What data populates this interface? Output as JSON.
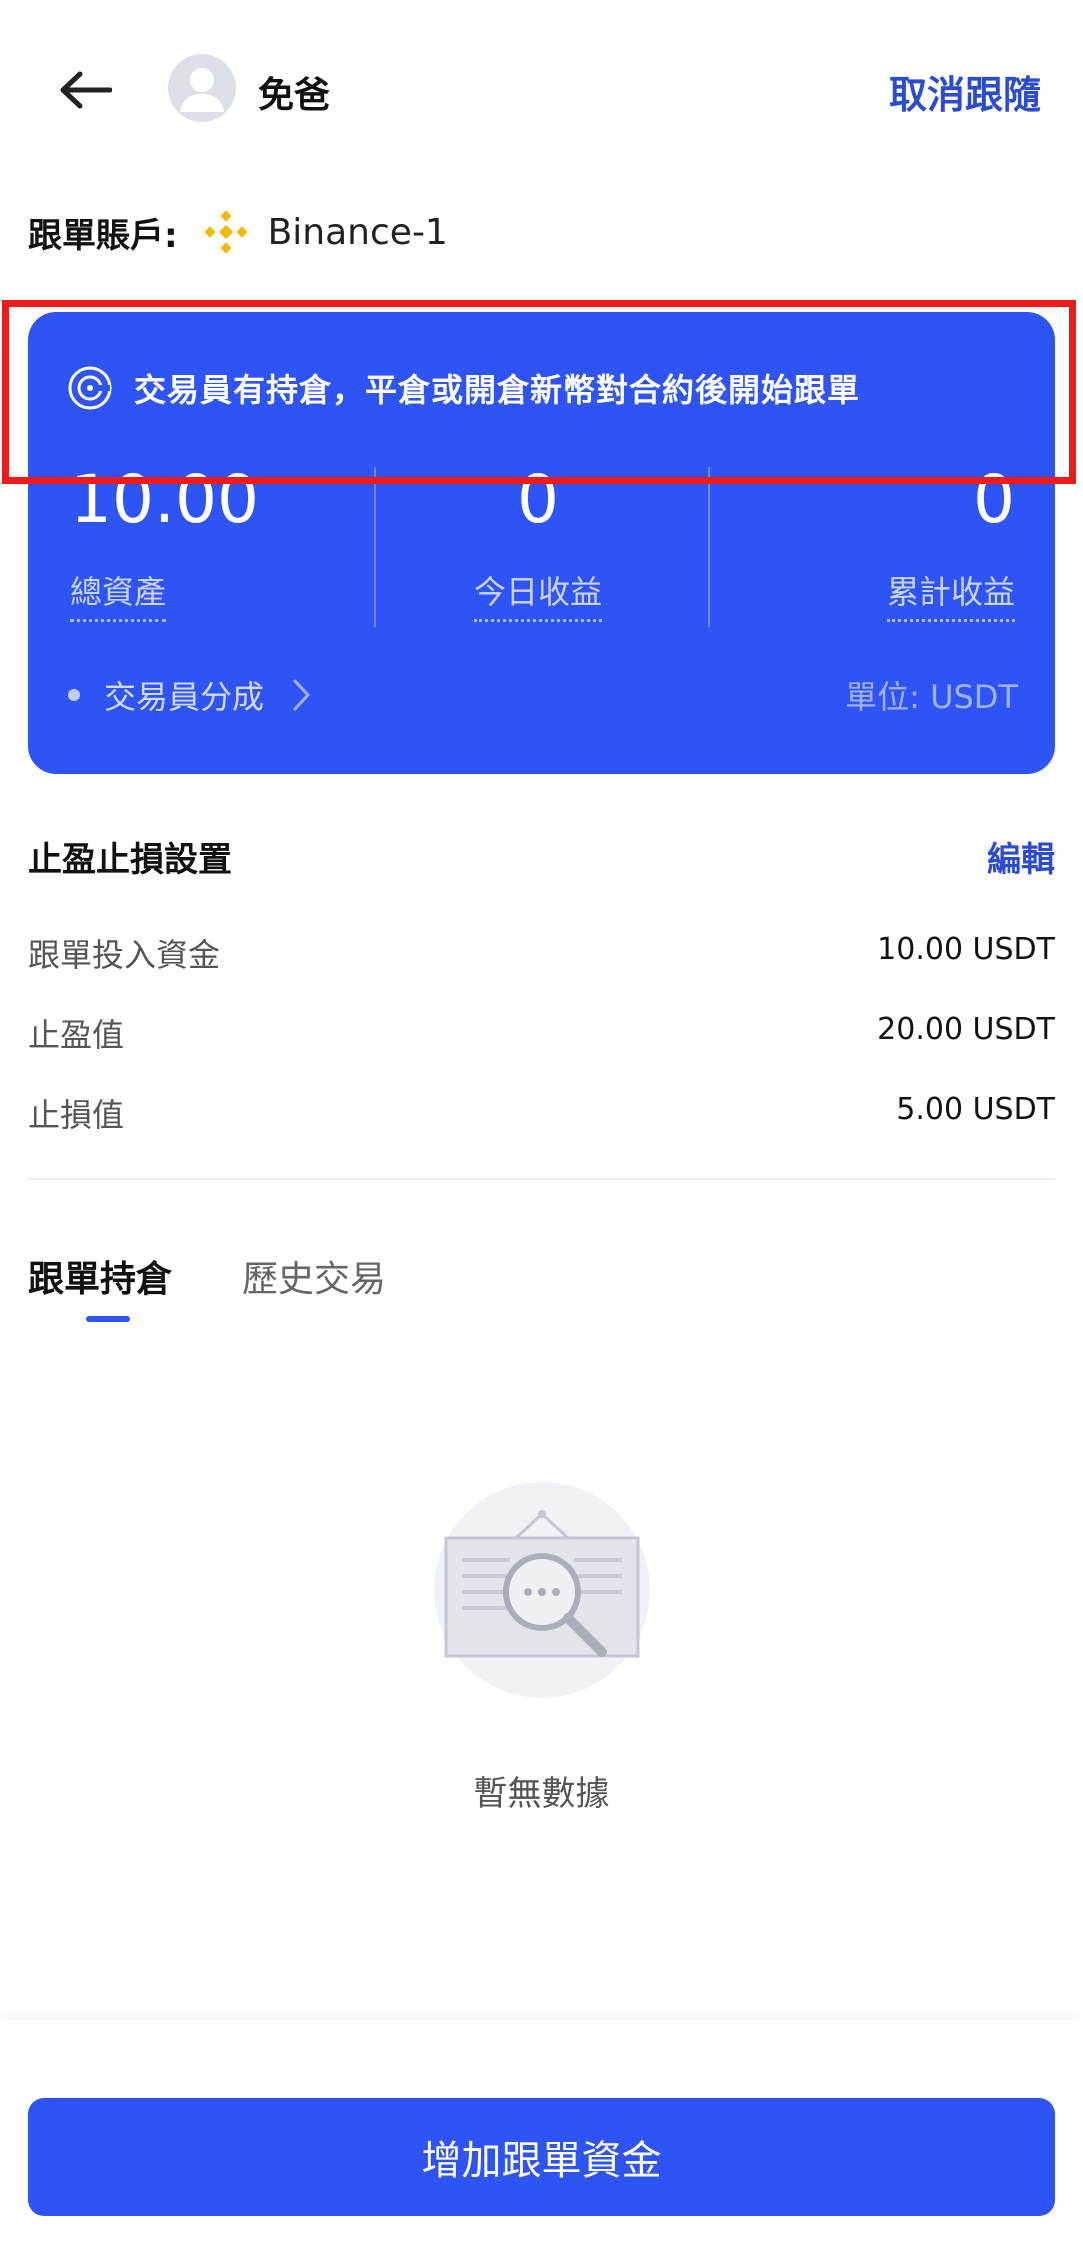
{
  "header": {
    "back_icon": "arrow-left-icon",
    "username": "免爸",
    "unfollow_label": "取消跟隨"
  },
  "account": {
    "label": "跟單賬戶:",
    "exchange_icon": "binance-icon",
    "name": "Binance-1"
  },
  "card": {
    "bg_color": "#2f54f5",
    "notice": "交易員有持倉，平倉或開倉新幣對合約後開始跟單",
    "stats": [
      {
        "value": "10.00",
        "label": "總資產"
      },
      {
        "value": "0",
        "label": "今日收益"
      },
      {
        "value": "0",
        "label": "累計收益"
      }
    ],
    "trader_share_label": "交易員分成",
    "unit": "單位: USDT"
  },
  "tpsl": {
    "title": "止盈止損設置",
    "edit_label": "編輯",
    "rows": [
      {
        "label": "跟單投入資金",
        "value": "10.00 USDT"
      },
      {
        "label": "止盈值",
        "value": "20.00 USDT"
      },
      {
        "label": "止損值",
        "value": "5.00 USDT"
      }
    ]
  },
  "tabs": [
    {
      "label": "跟單持倉",
      "active": true
    },
    {
      "label": "歷史交易",
      "active": false
    }
  ],
  "empty_state": {
    "icon": "empty-search-icon",
    "text": "暫無數據"
  },
  "bottom_button": {
    "label": "增加跟單資金"
  },
  "colors": {
    "accent": "#2f54f5",
    "link": "#2b4bd0",
    "highlight": "#f01a1a"
  }
}
